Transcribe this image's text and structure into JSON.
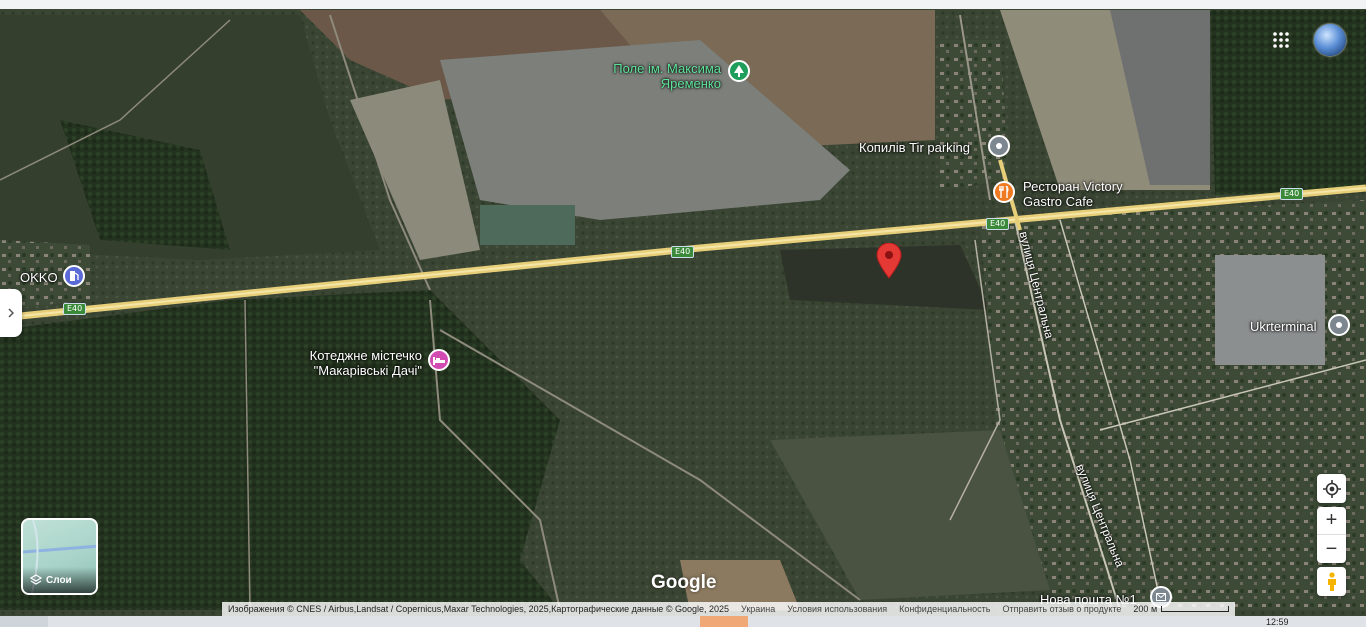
{
  "map": {
    "google_wordmark": "Google",
    "pois": [
      {
        "id": "pole",
        "label_lines": [
          "Поле ім. Максима",
          "Яременко"
        ],
        "icon": "tree-icon",
        "color": "#1e9e5a"
      },
      {
        "id": "kopyliv",
        "label_lines": [
          "Копилів Tir parking"
        ],
        "icon": "location-icon",
        "color": "#7d8790"
      },
      {
        "id": "victory",
        "label_lines": [
          "Ресторан Victory",
          "Gastro Cafe"
        ],
        "icon": "restaurant-icon",
        "color": "#ef7a22"
      },
      {
        "id": "okko",
        "label_lines": [
          "OKKO"
        ],
        "icon": "gas-station-icon",
        "color": "#5a6ad6"
      },
      {
        "id": "kotedzhne",
        "label_lines": [
          "Котеджне містечко",
          "\"Макарівські Дачі\""
        ],
        "icon": "hotel-icon",
        "color": "#d24bb3"
      },
      {
        "id": "ukrterminal",
        "label_lines": [
          "Ukrterminal"
        ],
        "icon": "location-icon",
        "color": "#7d8790"
      },
      {
        "id": "novaposhta",
        "label_lines": [
          "Нова пошта №1"
        ],
        "icon": "mail-icon",
        "color": "#7d8790"
      }
    ],
    "road_shields": [
      "E40",
      "E40",
      "E40",
      "E40"
    ],
    "streets": [
      "вулиця Центральна",
      "вулиця Центральна"
    ]
  },
  "controls": {
    "layers_label": "Слои",
    "zoom_in": "+",
    "zoom_out": "−"
  },
  "attribution": {
    "imagery": "Изображения © CNES / Airbus,Landsat / Copernicus,Maxar Technologies, 2025,Картографические данные © Google, 2025",
    "country": "Украина",
    "terms": "Условия использования",
    "privacy": "Конфиденциальность",
    "feedback": "Отправить отзыв о продукте",
    "scale": "200 м"
  },
  "taskbar": {
    "time": "12:59"
  }
}
